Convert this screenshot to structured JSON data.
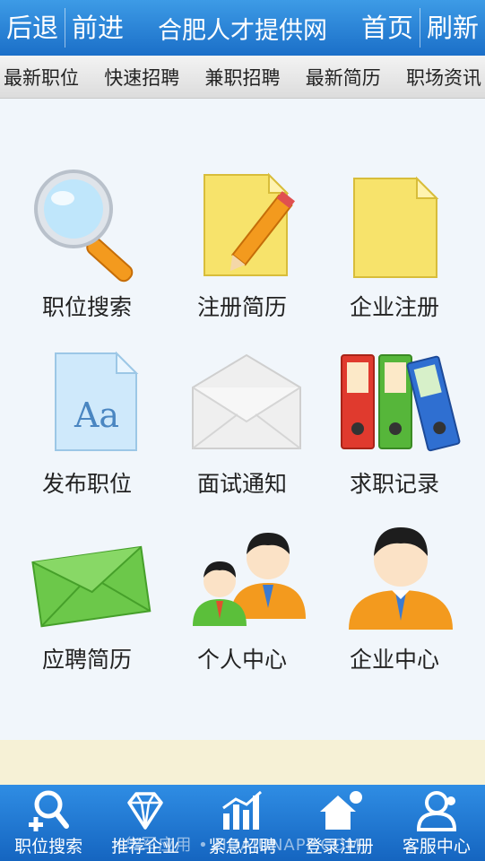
{
  "header": {
    "back_label": "后退",
    "forward_label": "前进",
    "title": "合肥人才提供网",
    "home_label": "首页",
    "refresh_label": "刷新"
  },
  "menu": {
    "items": [
      "最新职位",
      "快速招聘",
      "兼职招聘",
      "最新简历",
      "职场资讯"
    ]
  },
  "grid": {
    "items": [
      {
        "label": "职位搜索",
        "icon": "magnifier-icon"
      },
      {
        "label": "注册简历",
        "icon": "notepad-pencil-icon"
      },
      {
        "label": "企业注册",
        "icon": "blank-note-icon"
      },
      {
        "label": "发布职位",
        "icon": "font-document-icon"
      },
      {
        "label": "面试通知",
        "icon": "envelope-icon"
      },
      {
        "label": "求职记录",
        "icon": "binders-icon"
      },
      {
        "label": "应聘简历",
        "icon": "green-envelope-icon"
      },
      {
        "label": "个人中心",
        "icon": "two-people-icon"
      },
      {
        "label": "企业中心",
        "icon": "businessman-icon"
      }
    ]
  },
  "bottom_nav": {
    "items": [
      {
        "label": "职位搜索",
        "icon": "person-search-icon"
      },
      {
        "label": "推荐企业",
        "icon": "diamond-icon"
      },
      {
        "label": "紧急招聘",
        "icon": "bar-chart-icon"
      },
      {
        "label": "登录注册",
        "icon": "house-icon"
      },
      {
        "label": "客服中心",
        "icon": "service-icon"
      }
    ]
  },
  "watermark": "华军应用 • HUAJUNAPP.COM",
  "icon_letters": "Aa",
  "colors": {
    "header_blue": "#1b6fc8",
    "footer_strip": "#f6f1d6",
    "accent_orange": "#f39a1e"
  }
}
